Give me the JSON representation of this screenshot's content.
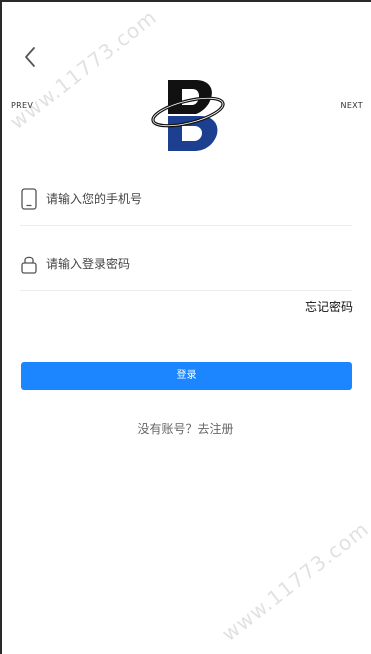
{
  "nav": {
    "back_icon": "chevron-left-icon"
  },
  "carousel": {
    "prev_label": "PREV",
    "next_label": "NEXT"
  },
  "logo": {
    "icon": "brand-b-logo",
    "colors": {
      "top": "#111111",
      "bottom": "#1d3f8f",
      "ring": "#111111"
    }
  },
  "form": {
    "phone": {
      "icon": "phone-icon",
      "placeholder": "请输入您的手机号",
      "value": ""
    },
    "password": {
      "icon": "lock-icon",
      "placeholder": "请输入登录密码",
      "value": ""
    },
    "forgot_label": "忘记密码",
    "submit_label": "登录",
    "register_label": "没有账号？去注册"
  },
  "theme": {
    "accent": "#1b86ff",
    "divider": "#ececec"
  },
  "watermark": {
    "text": "www.11773.com"
  }
}
